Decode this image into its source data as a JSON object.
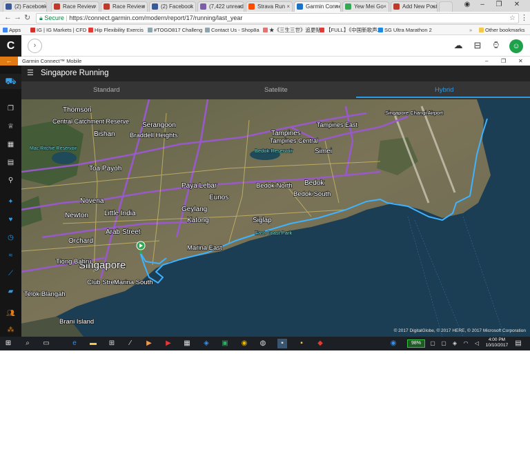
{
  "browser": {
    "tabs": [
      {
        "label": "(2) Facebook",
        "color": "#3b5998"
      },
      {
        "label": "Race Review",
        "color": "#c0392b"
      },
      {
        "label": "Race Review",
        "color": "#c0392b"
      },
      {
        "label": "(2) Facebook",
        "color": "#3b5998"
      },
      {
        "label": "(7,422 unread)",
        "color": "#7b5ea7"
      },
      {
        "label": "Strava Run",
        "color": "#fc4c02"
      },
      {
        "label": "Garmin Connect",
        "color": "#1a73c8"
      },
      {
        "label": "Yew Mei Go",
        "color": "#34a853"
      },
      {
        "label": "Add New Post",
        "color": "#c0392b"
      }
    ],
    "active_tab": 6,
    "secure_label": "Secure",
    "url": "https://connect.garmin.com/modern/report/17/running/last_year",
    "bookmarks": [
      {
        "label": "Apps",
        "color": "#4285f4"
      },
      {
        "label": "IG | IG Markets | CFD",
        "color": "#d32f2f"
      },
      {
        "label": "Hip Flexibility Exercis",
        "color": "#e53935"
      },
      {
        "label": "#TOGO817 Challeng",
        "color": "#90a4ae"
      },
      {
        "label": "Contact Us - Shop8a",
        "color": "#90a4ae"
      },
      {
        "label": "★《三生三世》追更贴",
        "color": "#e57373"
      },
      {
        "label": "【FULL】《中国新歌声2",
        "color": "#e53935"
      },
      {
        "label": "SG Ultra Marathon 2",
        "color": "#1e88e5"
      }
    ],
    "other_bookmarks": "Other bookmarks"
  },
  "garmin": {
    "app_title": "Garmin Connect™ Mobile",
    "page_title": "Singapore Running",
    "view_tabs": [
      "Standard",
      "Satellite",
      "Hybrid"
    ],
    "selected_view": "Hybrid",
    "map_copyright": "© 2017 DigitalGlobe, © 2017 HERE, © 2017 Microsoft Corporation",
    "accent_color": "#2c9be6",
    "route_color": "#3fb3ff"
  },
  "map_labels": {
    "places": [
      "Thomson",
      "Central Catchment Reserve",
      "Bishan",
      "Serangoon",
      "Braddell Heights",
      "Tampines",
      "Tampines Central",
      "Tampines East",
      "Simei",
      "Toa Payoh",
      "Paya Lebar",
      "Bedok North",
      "Bedok",
      "Bedok South",
      "Eunos",
      "Novena",
      "Newton",
      "Little India",
      "Arab Street",
      "Geylang",
      "Katong",
      "Siglap",
      "Orchard",
      "Singapore",
      "Marina East",
      "Tiong Bahru",
      "Club Street",
      "Marina South",
      "Telok Blangah",
      "Brani Island",
      "Singapore Changi Airport",
      "Mac Ritchie Reservoir",
      "Bedok Reservoir",
      "East Coast Park"
    ]
  },
  "taskbar": {
    "battery": "98%",
    "time": "4:00 PM",
    "date": "10/10/2017"
  }
}
